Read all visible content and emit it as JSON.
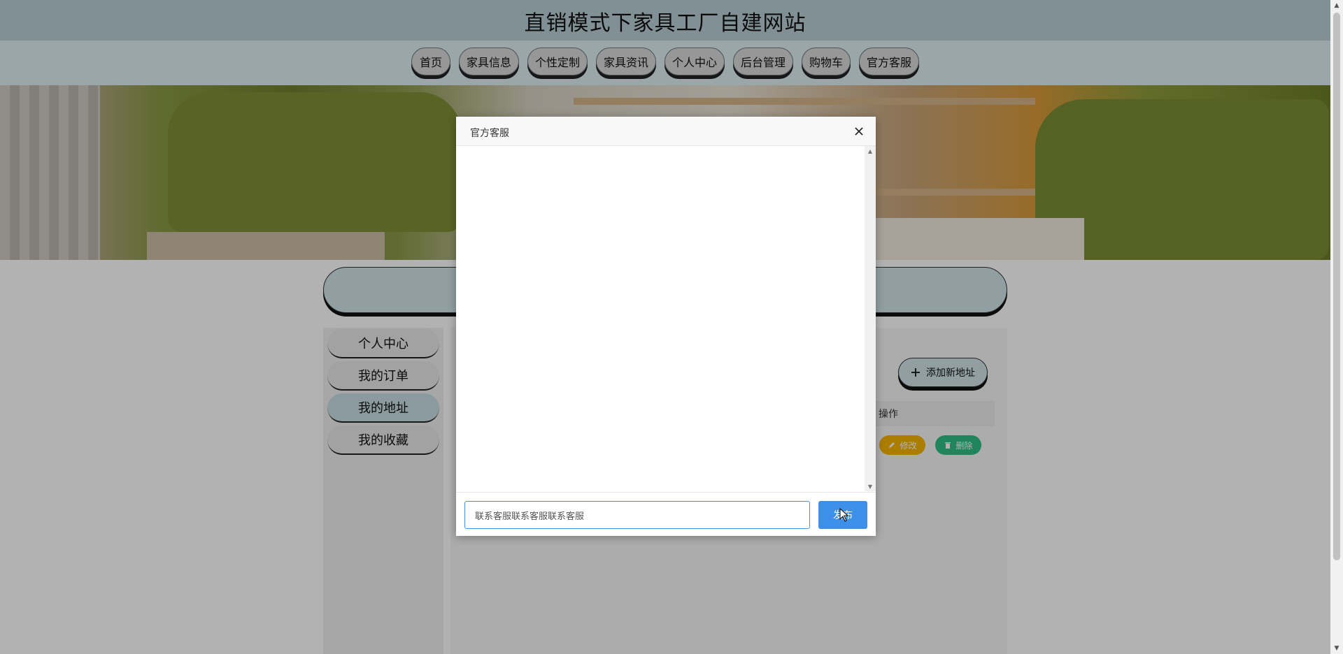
{
  "site": {
    "title": "直销模式下家具工厂自建网站"
  },
  "nav": {
    "items": [
      {
        "label": "首页"
      },
      {
        "label": "家具信息"
      },
      {
        "label": "个性定制"
      },
      {
        "label": "家具资讯"
      },
      {
        "label": "个人中心"
      },
      {
        "label": "后台管理"
      },
      {
        "label": "购物车"
      },
      {
        "label": "官方客服"
      }
    ]
  },
  "sidebar": {
    "items": [
      {
        "label": "个人中心"
      },
      {
        "label": "我的订单"
      },
      {
        "label": "我的地址"
      },
      {
        "label": "我的收藏"
      }
    ],
    "active": "我的地址"
  },
  "address": {
    "add_label": "添加新地址",
    "table_header_action": "操作",
    "edit_label": "修改",
    "delete_label": "删除"
  },
  "dialog": {
    "title": "官方客服",
    "input_value": "联系客服联系客服联系客服",
    "send_label": "发布"
  },
  "icons": {
    "close": "close-icon",
    "plus": "plus-icon",
    "edit": "pencil-icon",
    "delete": "trash-icon"
  },
  "colors": {
    "header_bg": "#b9cfd6",
    "nav_bg": "#deeef3",
    "send_button": "#3d8fe8",
    "edit_button": "#f5b400",
    "delete_button": "#2fbf84"
  }
}
